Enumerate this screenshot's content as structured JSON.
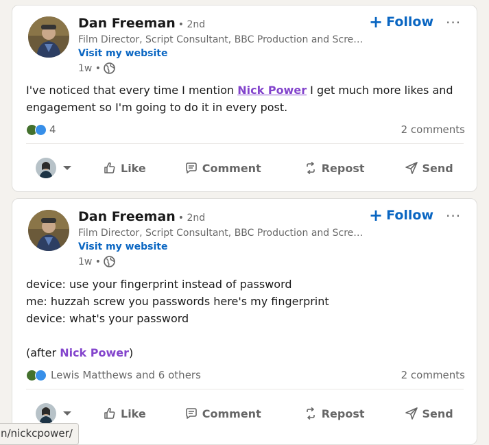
{
  "posts": [
    {
      "author": "Dan Freeman",
      "degree": "• 2nd",
      "headline": "Film Director, Script Consultant, BBC Production and Scree…",
      "website": "Visit my website",
      "time": "1w •",
      "follow_label": "Follow",
      "more_label": "···",
      "text_before": "I've noticed that every time I mention ",
      "mention": "Nick Power",
      "text_after": " I get much more likes and engagement so I'm going to do it in every post.",
      "reaction_count": "4",
      "comments": "2 comments"
    },
    {
      "author": "Dan Freeman",
      "degree": "• 2nd",
      "headline": "Film Director, Script Consultant, BBC Production and Scree…",
      "website": "Visit my website",
      "time": "1w •",
      "follow_label": "Follow",
      "more_label": "···",
      "lines": [
        "device: use your fingerprint instead of password",
        "me: huzzah screw you passwords here's my fingerprint",
        "device: what's your password"
      ],
      "after_open": "(after ",
      "mention": "Nick Power",
      "after_close": ")",
      "reaction_text": "Lewis Matthews and 6 others",
      "comments": "2 comments"
    }
  ],
  "actions": {
    "like": "Like",
    "comment": "Comment",
    "repost": "Repost",
    "send": "Send"
  },
  "tooltip_url": "n/nickcpower/",
  "colors": {
    "accent": "#0a66c2",
    "mention": "#8344cc",
    "background": "#f4f2ee"
  }
}
